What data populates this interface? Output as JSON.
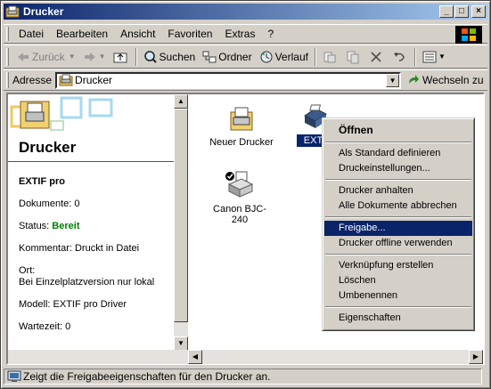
{
  "window": {
    "title": "Drucker",
    "minimize": "_",
    "maximize": "□",
    "close": "×"
  },
  "menu": [
    "Datei",
    "Bearbeiten",
    "Ansicht",
    "Favoriten",
    "Extras",
    "?"
  ],
  "toolbar": {
    "back": "Zurück",
    "search": "Suchen",
    "folders": "Ordner",
    "history": "Verlauf"
  },
  "address": {
    "label": "Adresse",
    "value": "Drucker",
    "go": "Wechseln zu"
  },
  "leftpane": {
    "title": "Drucker",
    "printer_name": "EXTIF pro",
    "documents": "Dokumente: 0",
    "status_label": "Status: ",
    "status_value": "Bereit",
    "comment": "Kommentar: Druckt in Datei",
    "location_label": "Ort:",
    "location_value": "Bei Einzelplatzversion nur lokal",
    "model": "Modell: EXTIF pro Driver",
    "queue": "Wartezeit: 0"
  },
  "icons": [
    {
      "label": "Neuer Drucker"
    },
    {
      "label": "EXTI"
    },
    {
      "label": "Canon BJC-240"
    }
  ],
  "context_menu": {
    "open": "Öffnen",
    "set_default": "Als Standard definieren",
    "preferences": "Druckeinstellungen...",
    "pause": "Drucker anhalten",
    "cancel_all": "Alle Dokumente abbrechen",
    "sharing": "Freigabe...",
    "offline": "Drucker offline verwenden",
    "shortcut": "Verknüpfung erstellen",
    "delete": "Löschen",
    "rename": "Umbenennen",
    "properties": "Eigenschaften"
  },
  "statusbar": {
    "text": "Zeigt die Freigabeeigenschaften für den Drucker an."
  },
  "colors": {
    "titlebar": "#0a246a",
    "selection": "#0a246a",
    "status_ready": "#008000"
  }
}
